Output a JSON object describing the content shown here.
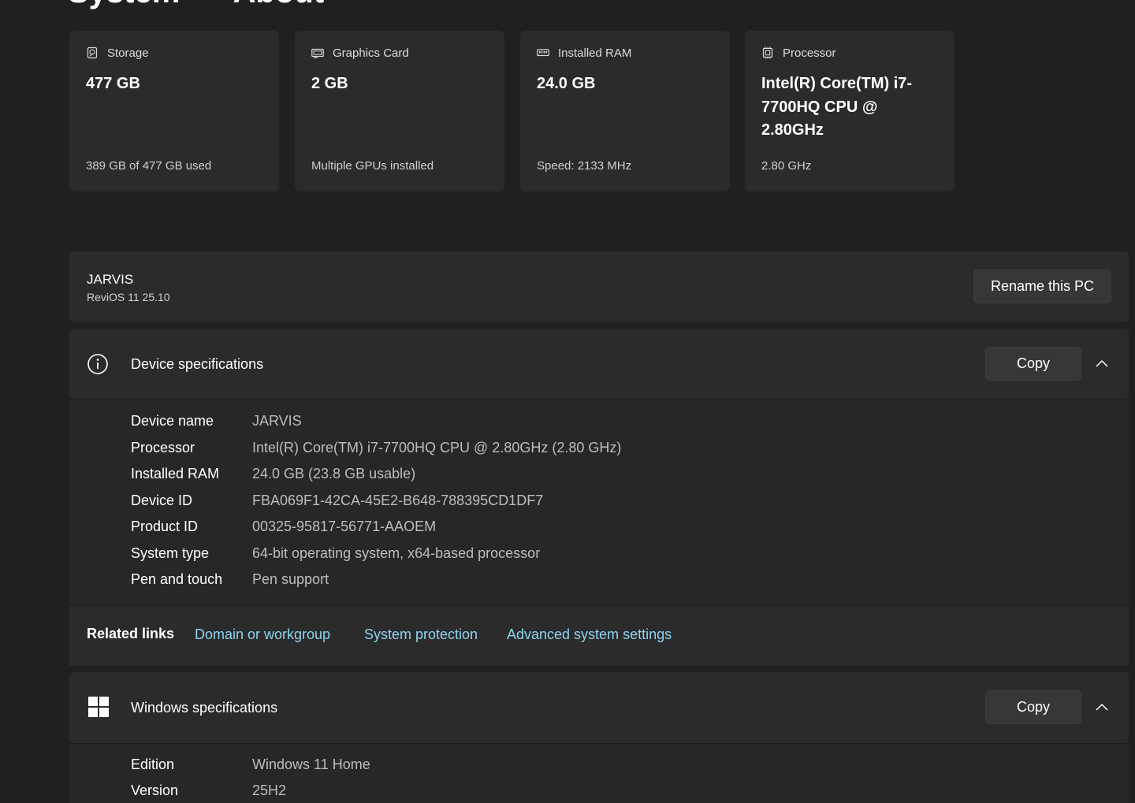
{
  "header": {
    "section": "System",
    "separator": ">",
    "page": "About"
  },
  "cards": [
    {
      "icon": "storage-drive-icon",
      "label": "Storage",
      "value": "477 GB",
      "sub": "389 GB of 477 GB used"
    },
    {
      "icon": "graphics-card-icon",
      "label": "Graphics Card",
      "value": "2 GB",
      "sub": "Multiple GPUs installed"
    },
    {
      "icon": "ram-module-icon",
      "label": "Installed RAM",
      "value": "24.0 GB",
      "sub": "Speed: 2133 MHz"
    },
    {
      "icon": "processor-chip-icon",
      "label": "Processor",
      "value": "Intel(R) Core(TM) i7-7700HQ CPU @ 2.80GHz",
      "sub": "2.80 GHz"
    }
  ],
  "pc": {
    "name": "JARVIS",
    "os": "ReviOS 11 25.10",
    "rename_label": "Rename this PC"
  },
  "device_specs": {
    "icon": "info-circle-icon",
    "title": "Device specifications",
    "copy_label": "Copy",
    "rows": [
      {
        "key": "Device name",
        "value": "JARVIS"
      },
      {
        "key": "Processor",
        "value": "Intel(R) Core(TM) i7-7700HQ CPU @ 2.80GHz (2.80 GHz)"
      },
      {
        "key": "Installed RAM",
        "value": "24.0 GB (23.8 GB usable)"
      },
      {
        "key": "Device ID",
        "value": "FBA069F1-42CA-45E2-B648-788395CD1DF7"
      },
      {
        "key": "Product ID",
        "value": "00325-95817-56771-AAOEM"
      },
      {
        "key": "System type",
        "value": "64-bit operating system, x64-based processor"
      },
      {
        "key": "Pen and touch",
        "value": "Pen support"
      }
    ]
  },
  "related_links": {
    "title": "Related links",
    "links": [
      "Domain or workgroup",
      "System protection",
      "Advanced system settings"
    ]
  },
  "windows_specs": {
    "icon": "windows-logo-icon",
    "title": "Windows specifications",
    "copy_label": "Copy",
    "rows": [
      {
        "key": "Edition",
        "value": "Windows 11 Home"
      },
      {
        "key": "Version",
        "value": "25H2"
      }
    ]
  }
}
